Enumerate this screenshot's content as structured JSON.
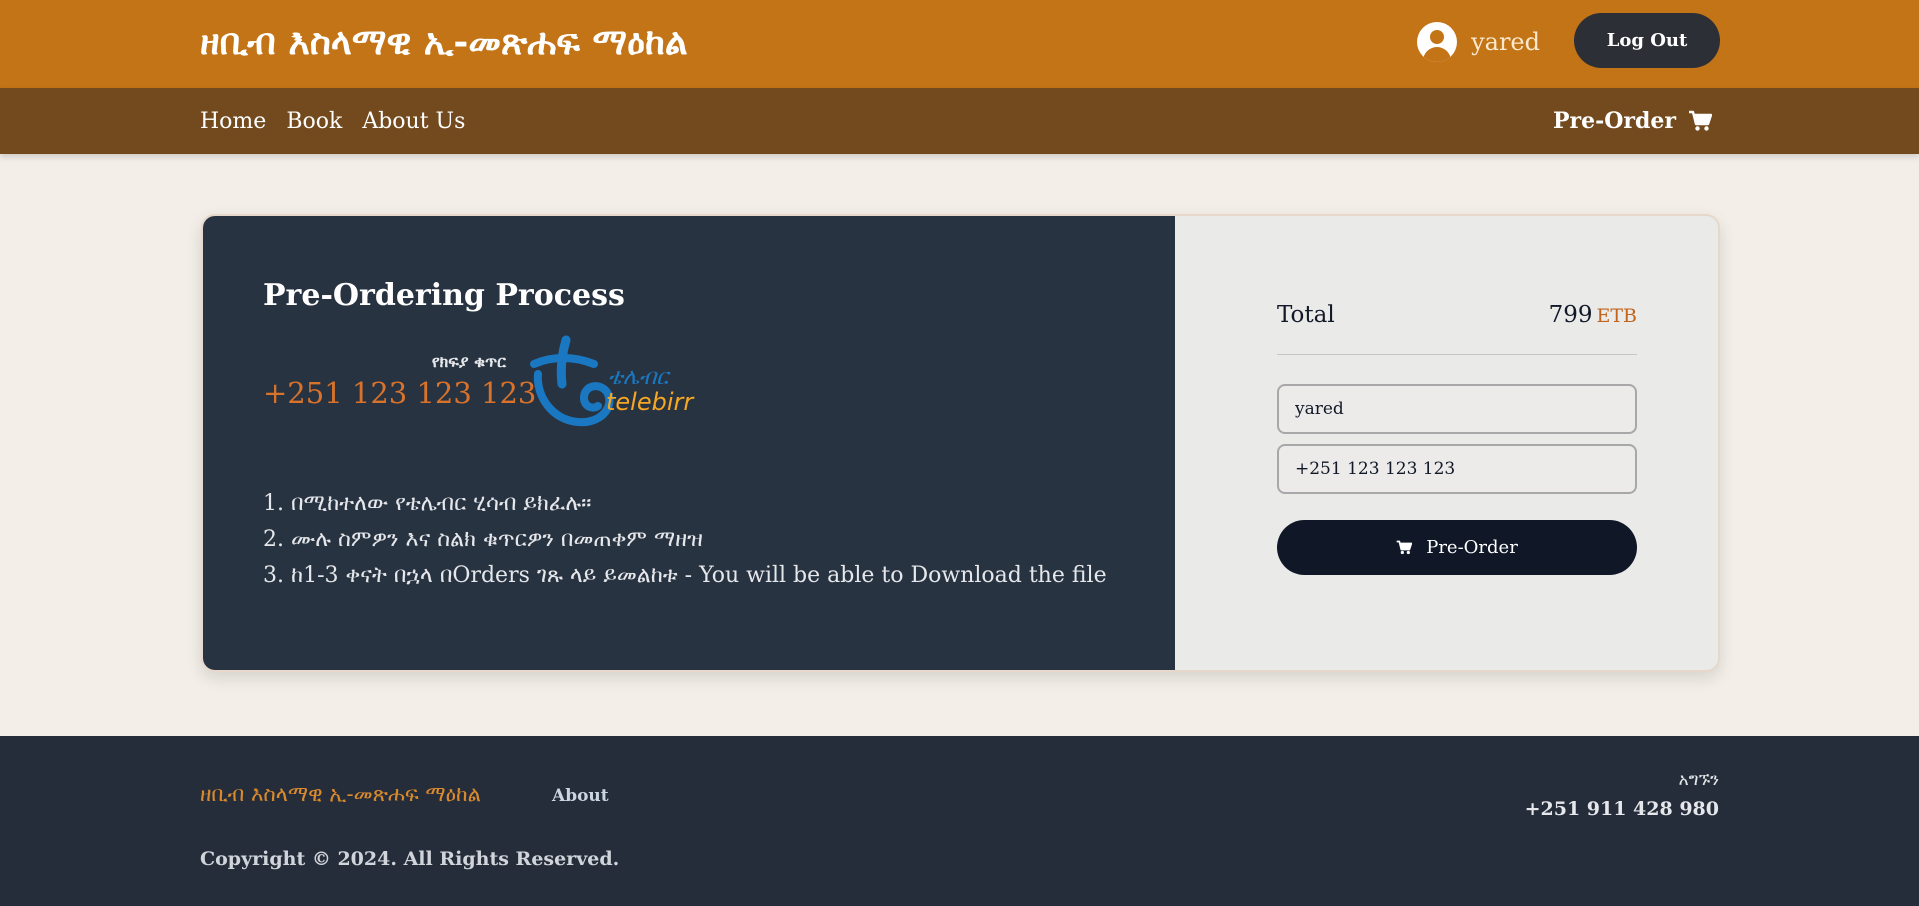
{
  "header": {
    "site_title": "ዘቢብ እስላማዊ ኢ-መጽሐፍ ማዕከል",
    "username": "yared",
    "logout_label": "Log Out"
  },
  "nav": {
    "links": [
      "Home",
      "Book",
      "About Us"
    ],
    "preorder_label": "Pre-Order"
  },
  "process": {
    "title": "Pre-Ordering Process",
    "payment_label": "የክፍያ ቁጥር",
    "payment_number": "+251 123 123 123",
    "logo_text_amharic": "ቴሌብር",
    "logo_text_latin": "telebirr",
    "steps": [
      "1. በሚከተለው የቴሌብር ሂሳብ ይክፈሉ።",
      "2. ሙሉ ስምዎን እና ስልክ ቁጥርዎን በመጠቀም ማዘዝ",
      "3. ከ1-3 ቀናት በኋላ በOrders ገጹ ላይ ይመልከቱ - You will be able to Download the file"
    ]
  },
  "order": {
    "total_label": "Total",
    "total_amount": "799",
    "currency": "ETB",
    "name_value": "yared",
    "phone_value": "+251 123 123 123",
    "button_label": "Pre-Order"
  },
  "footer": {
    "brand": "ዘቢብ እስላማዊ ኢ-መጽሐፍ ማዕከል",
    "about_label": "About",
    "contact_label": "አግኙን",
    "contact_phone": "+251 911 428 980",
    "copyright": "Copyright © 2024. All Rights Reserved."
  },
  "colors": {
    "header_bg": "#c27416",
    "nav_bg": "#734a1e",
    "card_left_bg": "#283341",
    "accent_orange": "#d9722a",
    "button_dark": "#101828",
    "footer_bg": "#262d3a"
  },
  "icons": [
    "user-avatar-icon",
    "cart-icon",
    "telebirr-logo"
  ]
}
